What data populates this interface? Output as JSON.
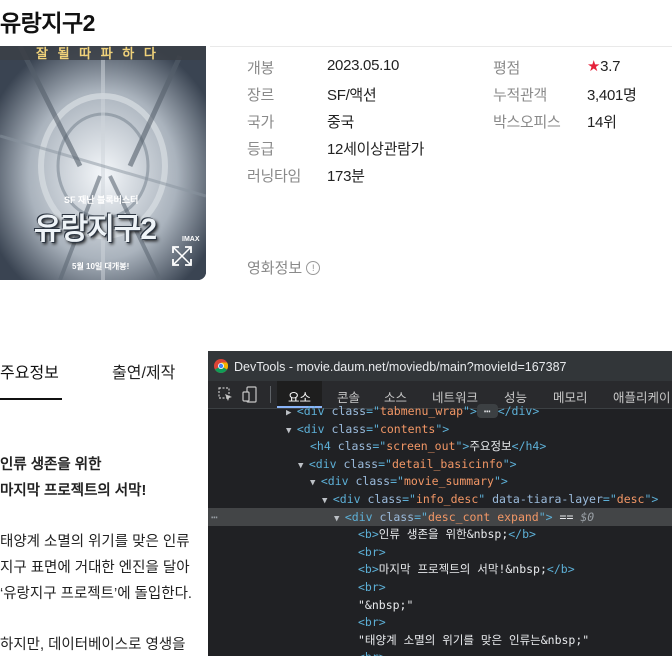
{
  "page": {
    "title": "유랑지구2"
  },
  "poster": {
    "tagline": "SF 재난 블록버스터",
    "logo_text": "유랑지구2",
    "top_text": "잘 될 따 파 하 다",
    "release_text": "5월 10일 대개봉!",
    "imax_text": "IMAX"
  },
  "info": {
    "left": [
      {
        "label": "개봉",
        "value": "2023.05.10"
      },
      {
        "label": "장르",
        "value": "SF/액션"
      },
      {
        "label": "국가",
        "value": "중국"
      },
      {
        "label": "등급",
        "value": "12세이상관람가"
      },
      {
        "label": "러닝타임",
        "value": "173분"
      }
    ],
    "right": [
      {
        "label": "평점",
        "value": "3.7",
        "star": "★"
      },
      {
        "label": "누적관객",
        "value": "3,401명"
      },
      {
        "label": "박스오피스",
        "value": "14위"
      }
    ],
    "movie_info_label": "영화정보",
    "info_icon_glyph": "!"
  },
  "tabs": [
    "주요정보",
    "출연/제작"
  ],
  "content": {
    "line1": "인류 생존을 위한",
    "line2": "마지막 프로젝트의 서막!",
    "para1": [
      "태양계 소멸의 위기를 맞은 인류",
      "지구 표면에 거대한 엔진을 달아",
      "‘유랑지구 프로젝트’에 돌입한다."
    ],
    "para2": "하지만, 데이터베이스로 영생을 "
  },
  "devtools": {
    "window_title": "DevTools - movie.daum.net/moviedb/main?movieId=167387",
    "tabs": [
      "요소",
      "콘솔",
      "소스",
      "네트워크",
      "성능",
      "메모리",
      "애플리케이"
    ],
    "tree": [
      {
        "indent": 0,
        "arrow": "▶",
        "open": "div",
        "attrs": [
          [
            "class",
            "tabmenu_wrap"
          ]
        ],
        "tail": " ⋯ </div>"
      },
      {
        "indent": 0,
        "arrow": "▼",
        "open": "div",
        "attrs": [
          [
            "class",
            "contents"
          ]
        ],
        "tail": ""
      },
      {
        "indent": 1,
        "arrow": "",
        "open": "h4",
        "attrs": [
          [
            "class",
            "screen_out"
          ]
        ],
        "text": "주요정보",
        "close": "h4"
      },
      {
        "indent": 1,
        "arrow": "▼",
        "open": "div",
        "attrs": [
          [
            "class",
            "detail_basicinfo"
          ]
        ],
        "tail": ""
      },
      {
        "indent": 2,
        "arrow": "▼",
        "open": "div",
        "attrs": [
          [
            "class",
            "movie_summary"
          ]
        ],
        "tail": ""
      },
      {
        "indent": 3,
        "arrow": "▼",
        "open": "div",
        "attrs": [
          [
            "class",
            "info_desc"
          ],
          [
            "data-tiara-layer",
            "desc"
          ]
        ],
        "tail": ""
      },
      {
        "indent": 4,
        "arrow": "▼",
        "open": "div",
        "attrs": [
          [
            "class",
            "desc_cont expand"
          ]
        ],
        "tail": " == $0",
        "selected": true
      },
      {
        "indent": 5,
        "arrow": "",
        "open": "b",
        "attrs": [],
        "text": "인류 생존을 위한&nbsp;",
        "close": "b"
      },
      {
        "indent": 5,
        "arrow": "",
        "open": "br",
        "attrs": [],
        "tail": ""
      },
      {
        "indent": 5,
        "arrow": "",
        "open": "b",
        "attrs": [],
        "text": "마지막 프로젝트의 서막!&nbsp;",
        "close": "b"
      },
      {
        "indent": 5,
        "arrow": "",
        "open": "br",
        "attrs": [],
        "tail": ""
      },
      {
        "indent": 5,
        "arrow": "",
        "rawtext": "\"&nbsp;\""
      },
      {
        "indent": 5,
        "arrow": "",
        "open": "br",
        "attrs": [],
        "tail": ""
      },
      {
        "indent": 5,
        "arrow": "",
        "rawtext": "\"태양계 소멸의 위기를 맞은 인류는&nbsp;\""
      },
      {
        "indent": 5,
        "arrow": "",
        "open": "br",
        "attrs": [],
        "tail": ""
      }
    ],
    "dots": "⋯"
  },
  "colors": {
    "accent_star": "#e5213a",
    "devtools_bg": "#202124",
    "devtools_tag": "#5db0d7",
    "devtools_attr_value": "#f29766"
  }
}
